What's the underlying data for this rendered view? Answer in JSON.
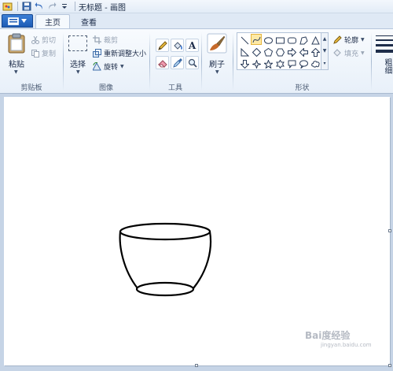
{
  "window": {
    "title": "无标题 - 画图"
  },
  "tabs": [
    {
      "label": "主页",
      "active": true
    },
    {
      "label": "查看",
      "active": false
    }
  ],
  "ribbon": {
    "clipboard": {
      "label": "剪贴板",
      "paste": "粘贴",
      "cut": "剪切",
      "copy": "复制"
    },
    "image": {
      "label": "图像",
      "select": "选择",
      "crop": "裁剪",
      "resize": "重新调整大小",
      "rotate": "旋转"
    },
    "tools": {
      "label": "工具",
      "icons": [
        "pencil-icon",
        "fill-icon",
        "text-icon",
        "eraser-icon",
        "color-picker-icon",
        "magnifier-icon"
      ]
    },
    "brushes": {
      "label": "刷子"
    },
    "shapes": {
      "label": "形状",
      "outline": "轮廓",
      "fill": "填充",
      "selected_shape": "curve"
    },
    "size": {
      "label": "粗细"
    }
  },
  "colors": {
    "accent": "#1d5bb5",
    "ribbon_bg": "#e8f0f9",
    "canvas_bg": "#ffffff",
    "workspace_bg": "#c6d4e6",
    "drawing_stroke": "#000000"
  },
  "watermark": {
    "text": "Bai度经验",
    "subtext": "jingyan.baidu.com"
  }
}
